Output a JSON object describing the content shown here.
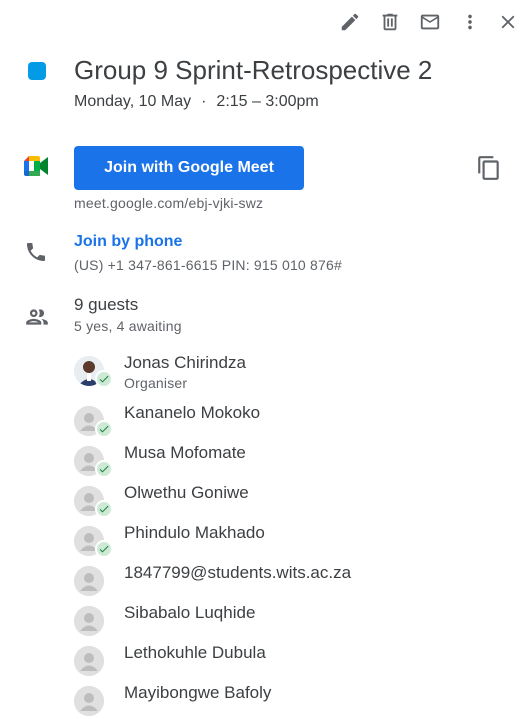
{
  "toolbar": {
    "edit": "edit-icon",
    "delete": "trash-icon",
    "email": "mail-icon",
    "more": "more-vert-icon",
    "close": "close-icon"
  },
  "event": {
    "color": "#039be5",
    "title": "Group 9 Sprint-Retrospective 2",
    "date": "Monday, 10 May",
    "separator": "·",
    "time": "2:15 – 3:00pm"
  },
  "meet": {
    "join_label": "Join with Google Meet",
    "link": "meet.google.com/ebj-vjki-swz",
    "accent": "#1a73e8"
  },
  "phone": {
    "join_label": "Join by phone",
    "details": "(US) +1 347-861-6615 PIN: 915 010 876#"
  },
  "guests": {
    "count_label": "9 guests",
    "summary": "5 yes, 4 awaiting",
    "list": [
      {
        "name": "Jonas Chirindza",
        "role": "Organiser",
        "accepted": true
      },
      {
        "name": "Kananelo Mokoko",
        "role": "",
        "accepted": true
      },
      {
        "name": "Musa Mofomate",
        "role": "",
        "accepted": true
      },
      {
        "name": "Olwethu Goniwe",
        "role": "",
        "accepted": true
      },
      {
        "name": "Phindulo Makhado",
        "role": "",
        "accepted": true
      },
      {
        "name": "1847799@students.wits.ac.za",
        "role": "",
        "accepted": false
      },
      {
        "name": "Sibabalo Luqhide",
        "role": "",
        "accepted": false
      },
      {
        "name": "Lethokuhle Dubula",
        "role": "",
        "accepted": false
      },
      {
        "name": "Mayibongwe Bafoly",
        "role": "",
        "accepted": false
      }
    ]
  }
}
